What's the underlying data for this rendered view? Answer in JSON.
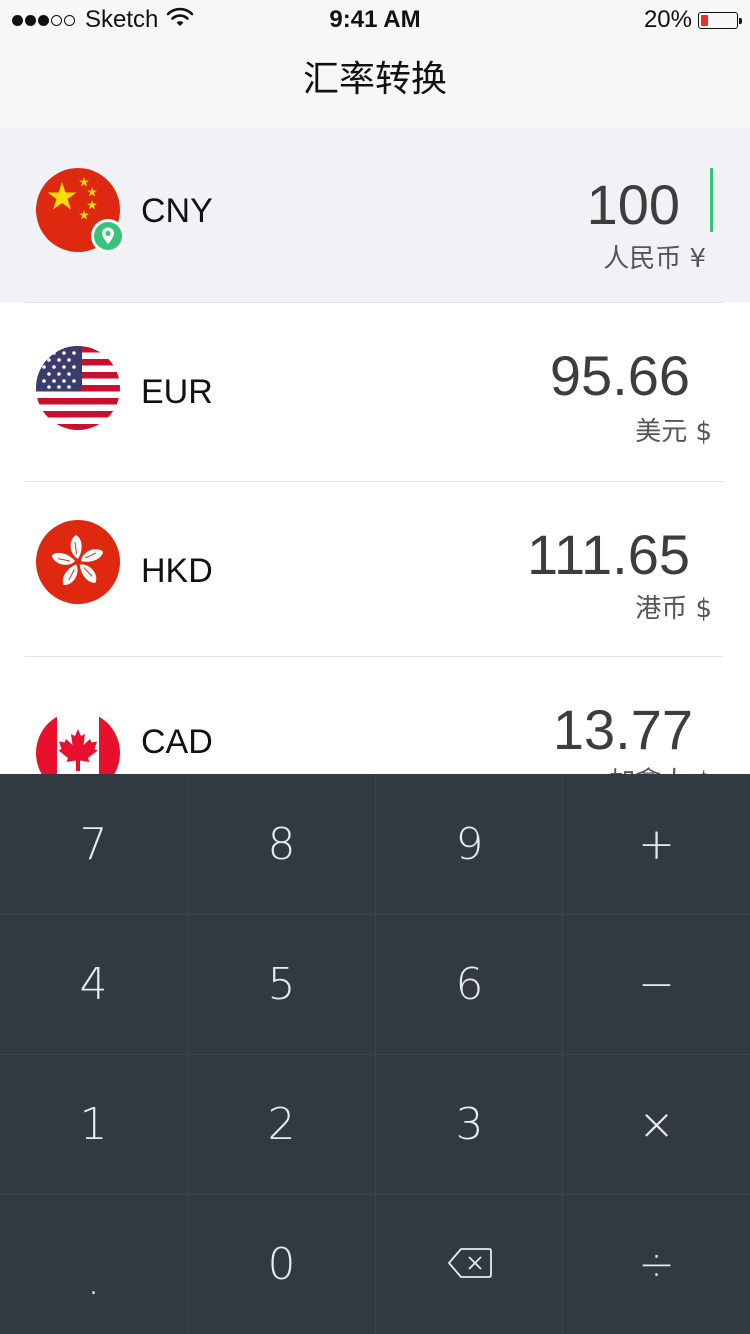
{
  "status_bar": {
    "carrier": "Sketch",
    "time": "9:41 AM",
    "battery_percent": "20%",
    "battery_level": 0.2,
    "signal_bars_filled": 3,
    "signal_bars_total": 5,
    "icons": [
      "signal-dots-icon",
      "wifi-icon",
      "battery-icon"
    ]
  },
  "nav": {
    "title": "汇率转换"
  },
  "currencies": [
    {
      "code": "CNY",
      "amount": "100",
      "name": "人民币 ¥",
      "flag": "china-flag-icon",
      "active": true,
      "location_marker": "location-pin-icon"
    },
    {
      "code": "EUR",
      "amount": "95.66",
      "name": "美元 $",
      "flag": "usa-flag-icon",
      "active": false
    },
    {
      "code": "HKD",
      "amount": "111.65",
      "name": "港币 $",
      "flag": "hong-kong-flag-icon",
      "active": false
    },
    {
      "code": "CAD",
      "amount": "13.77",
      "name": "加拿大 $",
      "flag": "canada-flag-icon",
      "active": false
    }
  ],
  "colors": {
    "cursor": "#35c47a",
    "location_badge": "#35c47a",
    "keypad_bg": "#313943",
    "active_row_bg": "#f1f2f5"
  },
  "keypad": {
    "keys": [
      {
        "label": "7",
        "name": "key-7"
      },
      {
        "label": "8",
        "name": "key-8"
      },
      {
        "label": "9",
        "name": "key-9"
      },
      {
        "label": "+",
        "name": "key-plus"
      },
      {
        "label": "4",
        "name": "key-4"
      },
      {
        "label": "5",
        "name": "key-5"
      },
      {
        "label": "6",
        "name": "key-6"
      },
      {
        "label": "−",
        "name": "key-minus"
      },
      {
        "label": "1",
        "name": "key-1"
      },
      {
        "label": "2",
        "name": "key-2"
      },
      {
        "label": "3",
        "name": "key-3"
      },
      {
        "label": "×",
        "name": "key-multiply"
      },
      {
        "label": ".",
        "name": "key-decimal"
      },
      {
        "label": "0",
        "name": "key-0"
      },
      {
        "label": "",
        "name": "key-backspace",
        "icon": "backspace-icon"
      },
      {
        "label": "÷",
        "name": "key-divide"
      }
    ]
  }
}
